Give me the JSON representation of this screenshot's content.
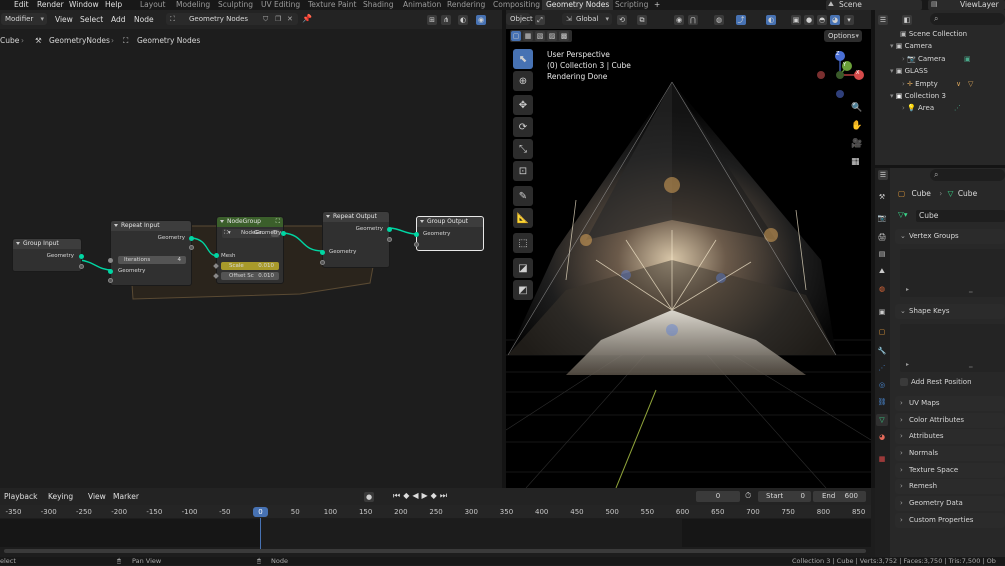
{
  "topbar": {
    "menu": [
      "Edit",
      "Render",
      "Window",
      "Help"
    ],
    "workspaces": [
      "Layout",
      "Modeling",
      "Sculpting",
      "UV Editing",
      "Texture Paint",
      "Shading",
      "Animation",
      "Rendering",
      "Compositing",
      "Geometry Nodes",
      "Scripting"
    ],
    "active_workspace": "Geometry Nodes",
    "add_workspace": "+",
    "scene": "Scene",
    "view_layer": "ViewLayer"
  },
  "node_editor": {
    "header": {
      "editor_type": "Modifier",
      "menus": [
        "View",
        "Select",
        "Add",
        "Node"
      ],
      "node_tree": "Geometry Nodes"
    },
    "breadcrumb": [
      "Cube",
      "GeometryNodes",
      "Geometry Nodes"
    ],
    "nodes": {
      "group_input": {
        "title": "Group Input",
        "geometry": "Geometry"
      },
      "repeat_input": {
        "title": "Repeat Input",
        "geometry_out": "Geometry",
        "iterations_label": "Iterations",
        "iterations_value": "4",
        "geometry_in": "Geometry"
      },
      "node_group": {
        "title": "NodeGroup",
        "selector": "NodeGr...",
        "geometry_out": "Geometry",
        "mesh": "Mesh",
        "scale_label": "Scale",
        "scale_value": "0.010",
        "offset_label": "Offset Sc",
        "offset_value": "0.010"
      },
      "repeat_output": {
        "title": "Repeat Output",
        "geometry_out": "Geometry",
        "geometry_in": "Geometry"
      },
      "group_output": {
        "title": "Group Output",
        "geometry": "Geometry"
      }
    }
  },
  "viewport": {
    "header": {
      "mode": "Object",
      "orientation": "Global",
      "options": "Options"
    },
    "overlay": {
      "line1": "User Perspective",
      "line2": "(0) Collection 3 | Cube",
      "line3": "Rendering Done"
    },
    "gizmo": {
      "z": "Z",
      "x": "X",
      "y": "Y"
    }
  },
  "outliner": {
    "rows": [
      {
        "label": "Scene Collection"
      },
      {
        "label": "Camera"
      },
      {
        "label": "Camera"
      },
      {
        "label": "GLASS"
      },
      {
        "label": "Empty"
      },
      {
        "label": "Collection 3"
      },
      {
        "label": "Area"
      }
    ]
  },
  "properties": {
    "breadcrumb": [
      "Cube",
      "Cube"
    ],
    "mesh_name": "Cube",
    "sections": {
      "vertex_groups": "Vertex Groups",
      "shape_keys": "Shape Keys",
      "add_rest_position": "Add Rest Position",
      "collapsed": [
        "UV Maps",
        "Color Attributes",
        "Attributes",
        "Normals",
        "Texture Space",
        "Remesh",
        "Geometry Data",
        "Custom Properties"
      ]
    }
  },
  "timeline": {
    "menus": [
      "Playback",
      "Keying",
      "View",
      "Marker"
    ],
    "current_frame": "0",
    "start_label": "Start",
    "start": "0",
    "end_label": "End",
    "end": "600",
    "ticks": [
      "-350",
      "-300",
      "-250",
      "-200",
      "-150",
      "-100",
      "-50",
      "0",
      "50",
      "100",
      "150",
      "200",
      "250",
      "300",
      "350",
      "400",
      "450",
      "500",
      "550",
      "600",
      "650",
      "700",
      "750",
      "800",
      "850"
    ],
    "playhead": "0"
  },
  "statusbar": {
    "select": "elect",
    "pan": "Pan View",
    "node": "Node",
    "stats": "Collection 3 | Cube | Verts:3,752 | Faces:3,750 | Tris:7,500 | Ob"
  },
  "colors": {
    "accent": "#4772b3",
    "socket_geometry": "#00d6a3",
    "node_group_header": "#3b5f2b",
    "frame": "#5a4a33"
  }
}
